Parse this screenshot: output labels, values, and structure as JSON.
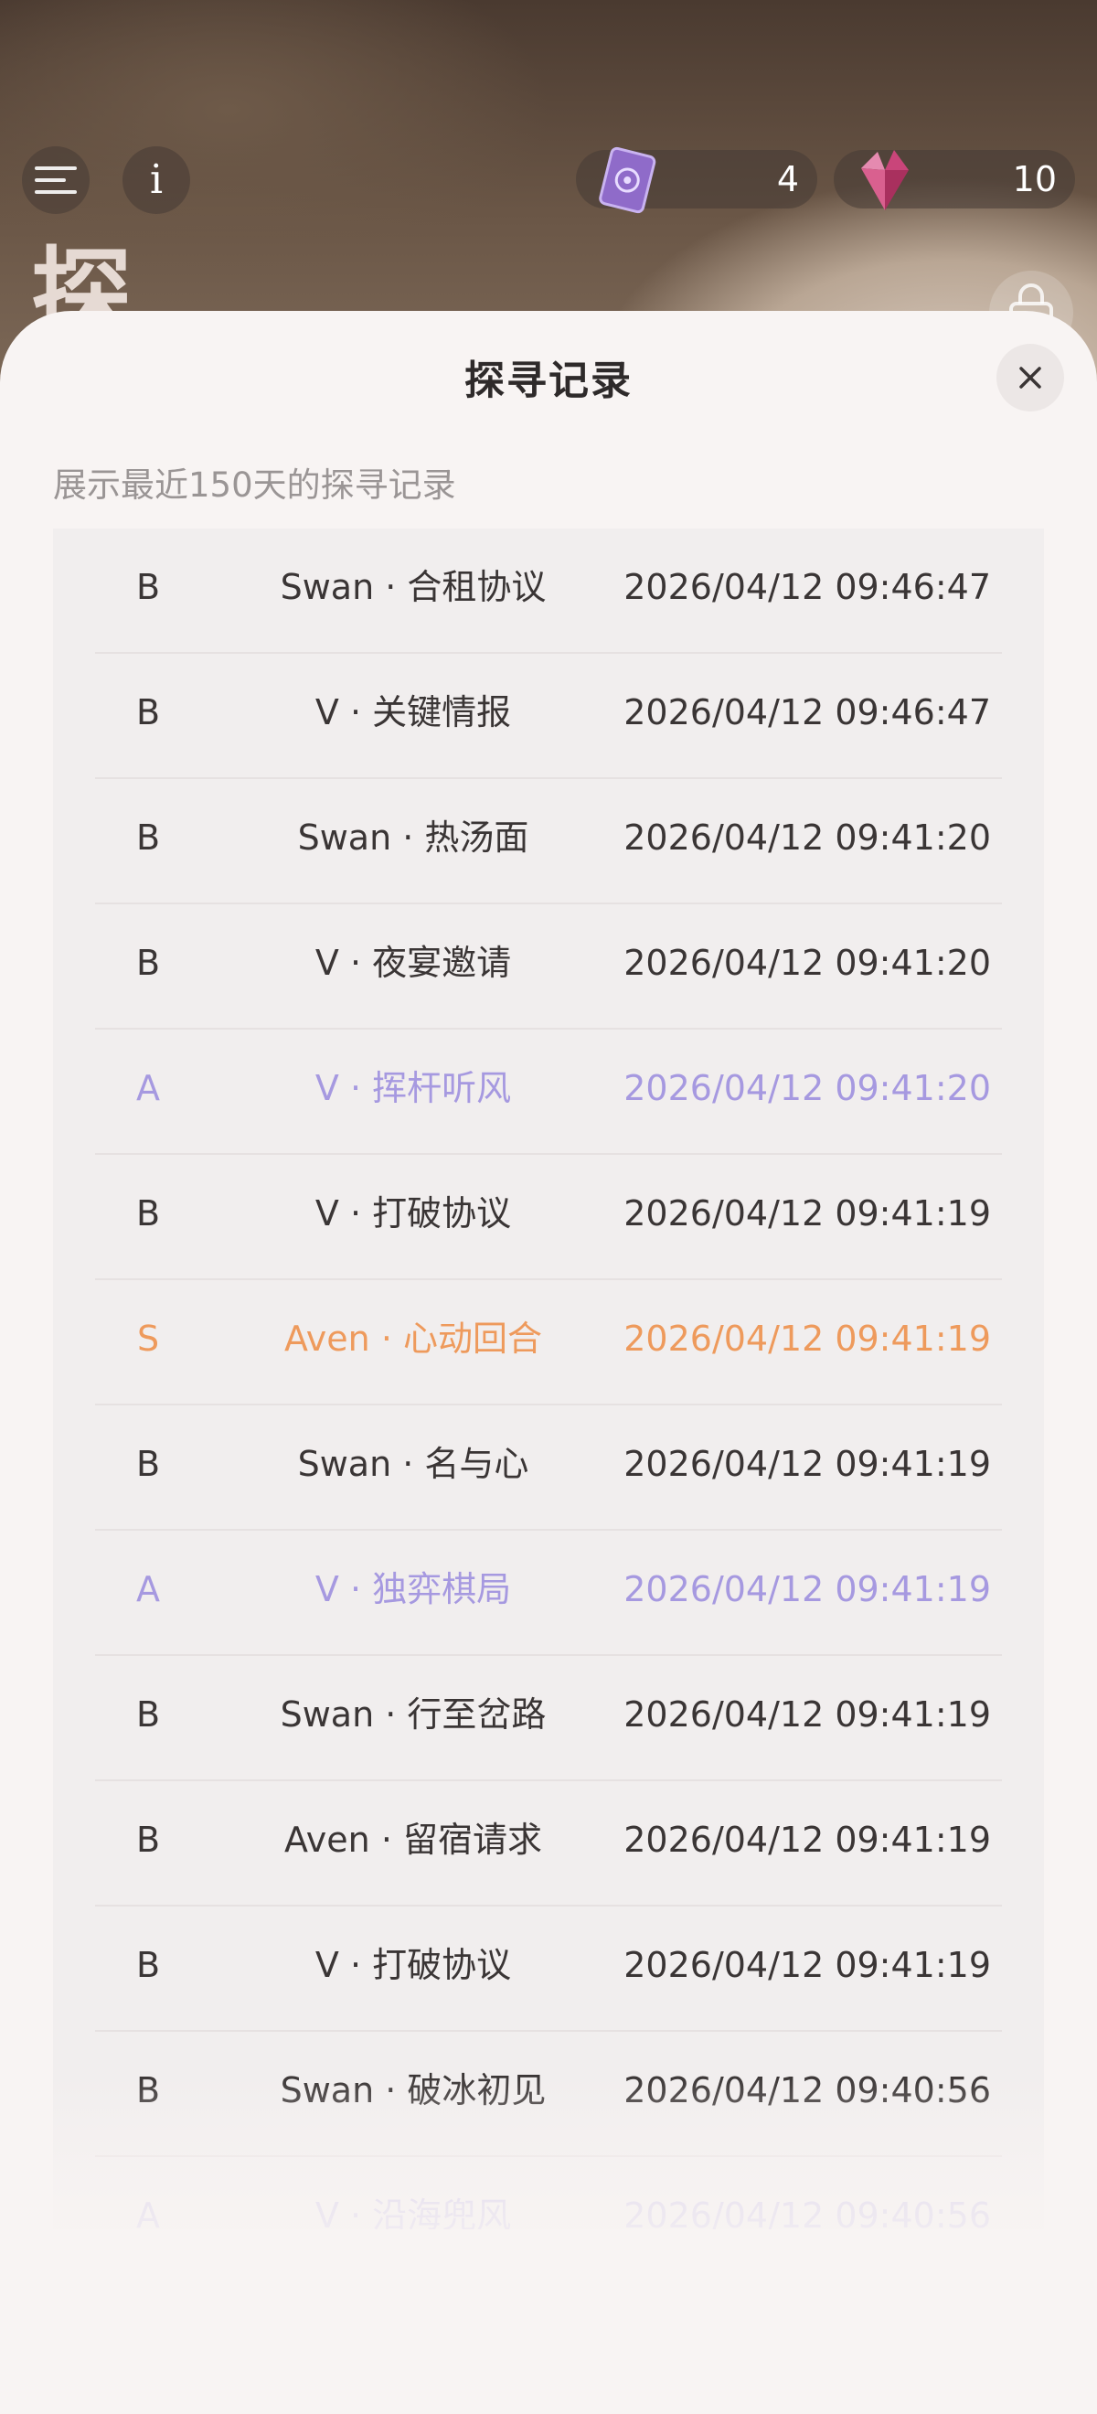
{
  "background": {
    "title_glyph": "探"
  },
  "header": {
    "menu_icon": "menu-icon",
    "info_label": "i",
    "currency": [
      {
        "icon": "purple-card-icon",
        "value": "4"
      },
      {
        "icon": "pink-crystal-icon",
        "value": "10"
      }
    ],
    "bag_icon": "bag-icon"
  },
  "modal": {
    "title": "探寻记录",
    "close_icon": "close-icon",
    "subtitle": "展示最近150天的探寻记录",
    "records": [
      {
        "rank": "B",
        "name": "Swan · 合租协议",
        "time": "2026/04/12 09:46:47"
      },
      {
        "rank": "B",
        "name": "V · 关键情报",
        "time": "2026/04/12 09:46:47"
      },
      {
        "rank": "B",
        "name": "Swan · 热汤面",
        "time": "2026/04/12 09:41:20"
      },
      {
        "rank": "B",
        "name": "V · 夜宴邀请",
        "time": "2026/04/12 09:41:20"
      },
      {
        "rank": "A",
        "name": "V · 挥杆听风",
        "time": "2026/04/12 09:41:20"
      },
      {
        "rank": "B",
        "name": "V · 打破协议",
        "time": "2026/04/12 09:41:19"
      },
      {
        "rank": "S",
        "name": "Aven · 心动回合",
        "time": "2026/04/12 09:41:19"
      },
      {
        "rank": "B",
        "name": "Swan · 名与心",
        "time": "2026/04/12 09:41:19"
      },
      {
        "rank": "A",
        "name": "V · 独弈棋局",
        "time": "2026/04/12 09:41:19"
      },
      {
        "rank": "B",
        "name": "Swan · 行至岔路",
        "time": "2026/04/12 09:41:19"
      },
      {
        "rank": "B",
        "name": "Aven · 留宿请求",
        "time": "2026/04/12 09:41:19"
      },
      {
        "rank": "B",
        "name": "V · 打破协议",
        "time": "2026/04/12 09:41:19"
      },
      {
        "rank": "B",
        "name": "Swan · 破冰初见",
        "time": "2026/04/12 09:40:56"
      },
      {
        "rank": "A",
        "name": "V · 沿海兜风",
        "time": "2026/04/12 09:40:56"
      }
    ]
  },
  "colors": {
    "rank_B": "#3a3535",
    "rank_A": "#a699e0",
    "rank_S": "#ee9a5c",
    "sheet_bg": "#f8f4f3",
    "list_bg": "#f1eeee"
  }
}
